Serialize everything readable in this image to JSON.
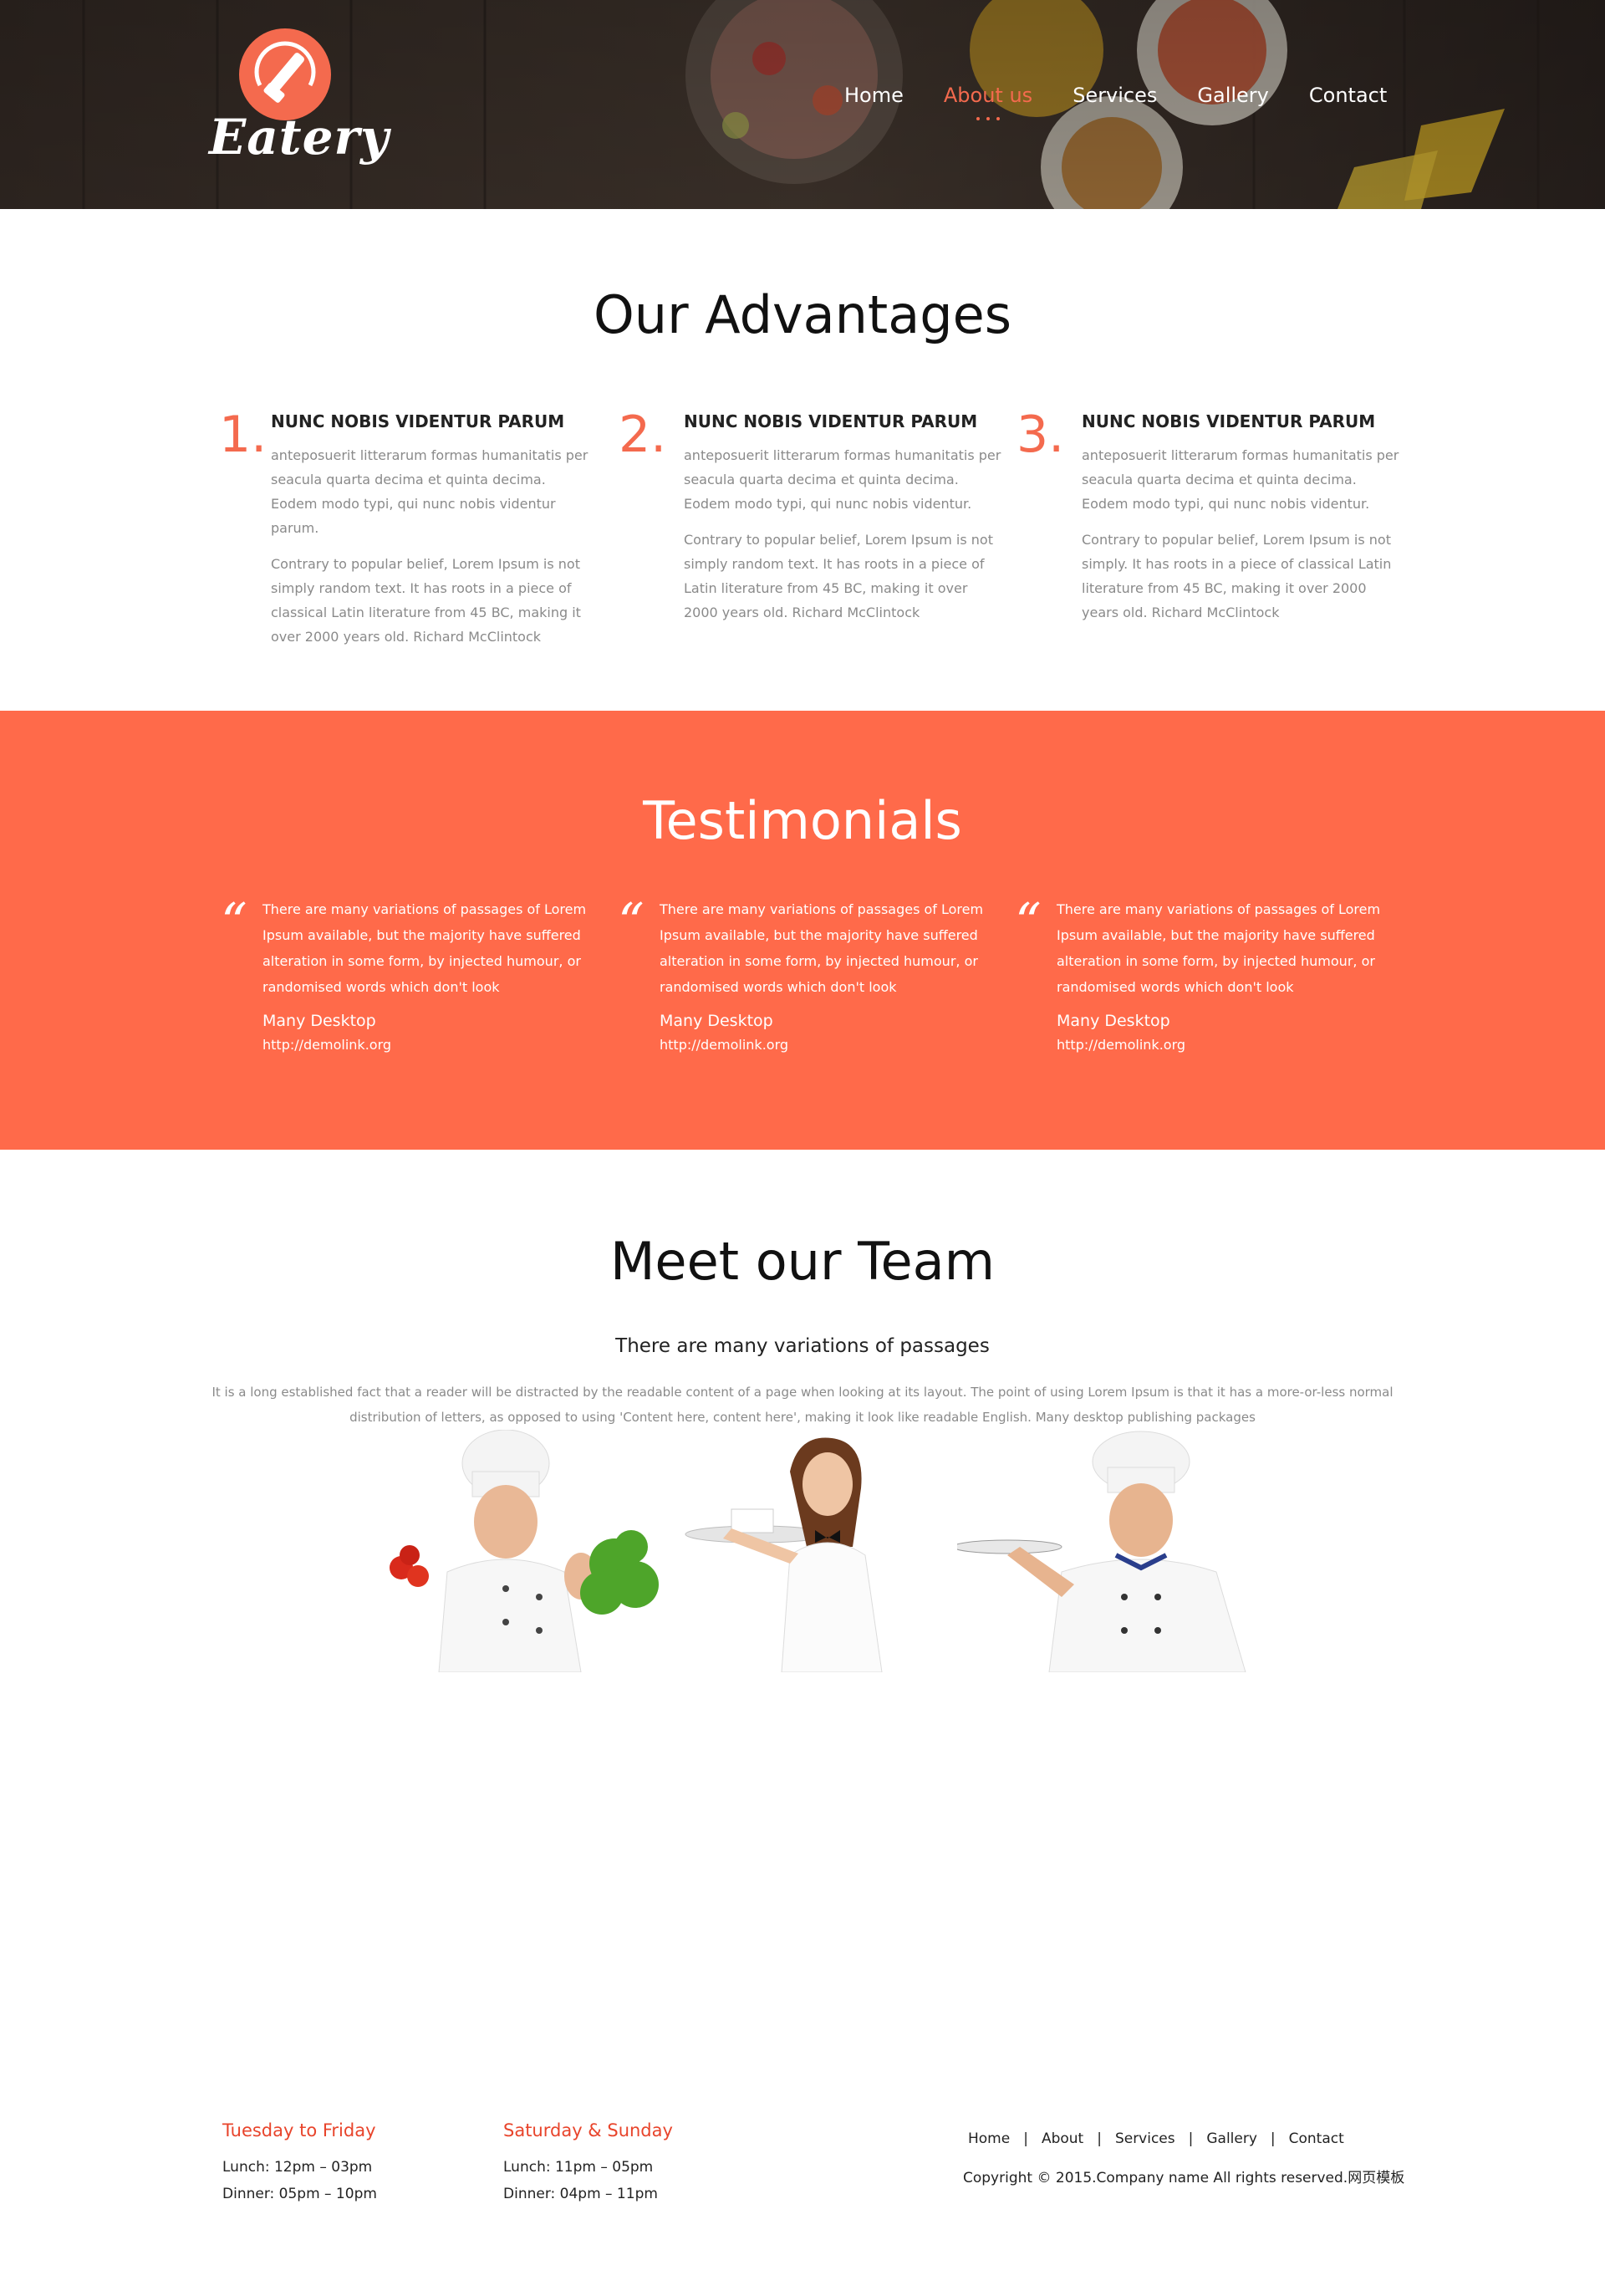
{
  "header": {
    "logo_text": "Eatery",
    "nav": [
      {
        "label": "Home",
        "active": false
      },
      {
        "label": "About us",
        "active": true
      },
      {
        "label": "Services",
        "active": false
      },
      {
        "label": "Gallery",
        "active": false
      },
      {
        "label": "Contact",
        "active": false
      }
    ]
  },
  "colors": {
    "accent": "#f46a4e",
    "testimonial_bg": "#ff6a4a",
    "footer_heading": "#e8442b"
  },
  "advantages": {
    "title": "Our Advantages",
    "items": [
      {
        "number": "1.",
        "heading": "NUNC NOBIS VIDENTUR PARUM",
        "p1": "anteposuerit litterarum formas humanitatis per seacula quarta decima et quinta decima. Eodem modo typi, qui nunc nobis videntur parum.",
        "p2": "Contrary to popular belief, Lorem Ipsum is not simply random text. It has roots in a piece of classical Latin literature from 45 BC, making it over 2000 years old. Richard McClintock"
      },
      {
        "number": "2.",
        "heading": "NUNC NOBIS VIDENTUR PARUM",
        "p1": "anteposuerit litterarum formas humanitatis per seacula quarta decima et quinta decima. Eodem modo typi, qui nunc nobis videntur.",
        "p2": "Contrary to popular belief, Lorem Ipsum is not simply random text. It has roots in a piece of Latin literature from 45 BC, making it over 2000 years old. Richard McClintock"
      },
      {
        "number": "3.",
        "heading": "NUNC NOBIS VIDENTUR PARUM",
        "p1": "anteposuerit litterarum formas humanitatis per seacula quarta decima et quinta decima. Eodem modo typi, qui nunc nobis videntur.",
        "p2": "Contrary to popular belief, Lorem Ipsum is not simply. It has roots in a piece of classical Latin literature from 45 BC, making it over 2000 years old. Richard McClintock"
      }
    ]
  },
  "testimonials": {
    "title": "Testimonials",
    "items": [
      {
        "text": "There are many variations of passages of Lorem Ipsum available, but the majority have suffered alteration in some form, by injected humour, or randomised words which don't look",
        "author": "Many Desktop",
        "link": "http://demolink.org"
      },
      {
        "text": "There are many variations of passages of Lorem Ipsum available, but the majority have suffered alteration in some form, by injected humour, or randomised words which don't look",
        "author": "Many Desktop",
        "link": "http://demolink.org"
      },
      {
        "text": "There are many variations of passages of Lorem Ipsum available, but the majority have suffered alteration in some form, by injected humour, or randomised words which don't look",
        "author": "Many Desktop",
        "link": "http://demolink.org"
      }
    ]
  },
  "team": {
    "title": "Meet our Team",
    "subtitle": "There are many variations of passages",
    "description": "It is a long established fact that a reader will be distracted by the readable content of a page when looking at its layout. The point of using Lorem Ipsum is that it has a more-or-less normal distribution of letters, as opposed to using 'Content here, content here', making it look like readable English. Many desktop publishing packages"
  },
  "footer": {
    "hours": [
      {
        "title": "Tuesday to Friday",
        "lunch": "Lunch: 12pm – 03pm",
        "dinner": "Dinner: 05pm – 10pm"
      },
      {
        "title": "Saturday & Sunday",
        "lunch": "Lunch: 11pm – 05pm",
        "dinner": "Dinner: 04pm – 11pm"
      }
    ],
    "links": [
      "Home",
      "About",
      "Services",
      "Gallery",
      "Contact"
    ],
    "separator": "|",
    "copyright": "Copyright © 2015.Company name All rights reserved.网页模板"
  }
}
